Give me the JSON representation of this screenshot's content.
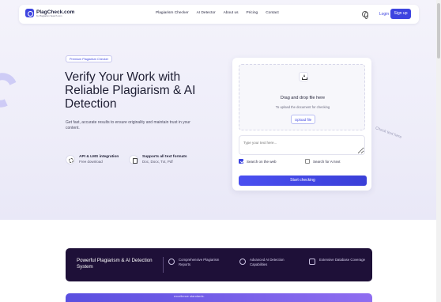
{
  "header": {
    "logo_text": "PlagCheck.com",
    "logo_sub": "by Plagiarism Search com",
    "nav": [
      "Plagiarism Checker",
      "AI Detector",
      "About us",
      "Pricing",
      "Contact"
    ],
    "login": "Login",
    "signup": "Sign up"
  },
  "hero": {
    "badge": "Premium Plagiarism Checker",
    "title": "Verify Your Work with Reliable Plagiarism & AI Detection",
    "description": "Get fast, accurate results to ensure originality and maintain trust in your content.",
    "features": [
      {
        "title": "API & LMS integration",
        "sub": "Free download"
      },
      {
        "title": "Supports all text formats",
        "sub": "Doc, Docx, Txt, Pdf"
      }
    ]
  },
  "upload": {
    "drop_title": "Drag and drop file here",
    "drop_sub": "To upload the document for checking",
    "upload_button": "Upload file",
    "text_placeholder": "Type your text here...",
    "check_web": "Search on the web",
    "check_ai": "Search for AI text",
    "check_web_on": true,
    "check_ai_on": false,
    "start_button": "Start checking"
  },
  "deco": {
    "check_text": "Check text here"
  },
  "banner": {
    "title": "Powerful Plagiarism & AI Detection System",
    "items": [
      "Comprehensive Plagiarism Reports",
      "Advanced AI Detection Capabilities",
      "Extensive Database Coverage"
    ]
  },
  "bottom": {
    "text": "excellence standards."
  },
  "colors": {
    "accent": "#3d44e0",
    "banner_bg": "#1e1038"
  }
}
